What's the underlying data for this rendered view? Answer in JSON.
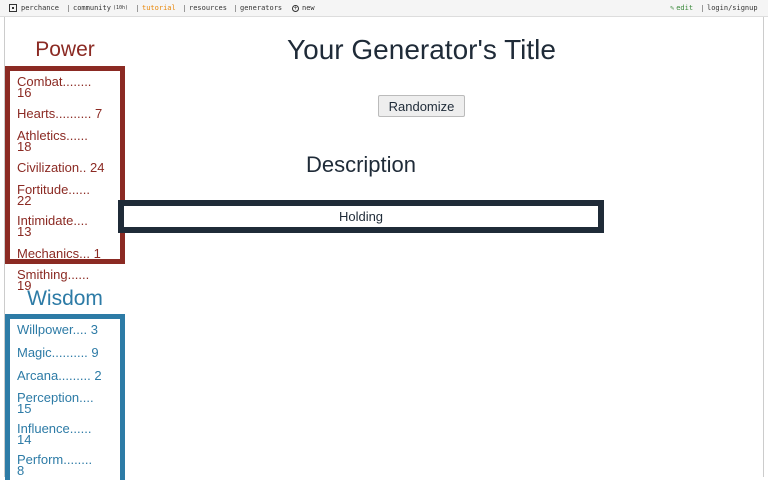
{
  "nav": {
    "perchance": "perchance",
    "community": "community",
    "community_count": "(10h)",
    "tutorial": "tutorial",
    "resources": "resources",
    "generators": "generators",
    "new": "new",
    "edit": "edit",
    "login": "login/signup"
  },
  "page": {
    "title": "Your Generator's Title",
    "randomize_label": "Randomize",
    "description_heading": "Description",
    "output_text": "Holding"
  },
  "power": {
    "title": "Power",
    "color": "#8b2a23",
    "items": [
      {
        "name": "Combat",
        "dots": "........",
        "value": "16"
      },
      {
        "name": "Hearts",
        "dots": "..........",
        "value": "7"
      },
      {
        "name": "Athletics",
        "dots": "......",
        "value": "18"
      },
      {
        "name": "Civilization",
        "dots": "..",
        "value": "24"
      },
      {
        "name": "Fortitude",
        "dots": "......",
        "value": "22"
      },
      {
        "name": "Intimidate",
        "dots": "....",
        "value": "13"
      },
      {
        "name": "Mechanics",
        "dots": "...",
        "value": "1"
      },
      {
        "name": "Smithing",
        "dots": "......",
        "value": "19"
      }
    ]
  },
  "wisdom": {
    "title": "Wisdom",
    "color": "#2d7ba6",
    "items": [
      {
        "name": "Willpower",
        "dots": "....",
        "value": "3"
      },
      {
        "name": "Magic",
        "dots": "..........",
        "value": "9"
      },
      {
        "name": "Arcana",
        "dots": ".........",
        "value": "2"
      },
      {
        "name": "Perception",
        "dots": "....",
        "value": "15"
      },
      {
        "name": "Influence",
        "dots": "......",
        "value": "14"
      },
      {
        "name": "Perform",
        "dots": "........",
        "value": "8"
      }
    ]
  }
}
